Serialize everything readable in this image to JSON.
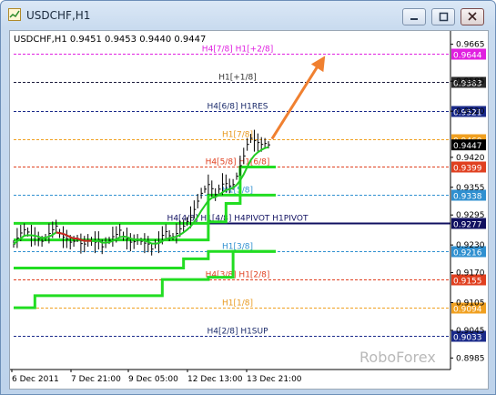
{
  "window": {
    "title": "USDCHF,H1"
  },
  "chart_data": {
    "type": "line",
    "symbol_info": "USDCHF,H1  0.9451 0.9453 0.9440 0.9447",
    "watermark": "RoboForex",
    "y_ticks": [
      "0.9665",
      "0.9585",
      "0.9520",
      "0.9420",
      "0.9355",
      "0.9295",
      "0.9230",
      "0.9170",
      "0.9105",
      "0.9045",
      "0.8985"
    ],
    "x_ticks": [
      "6 Dec 2011",
      "7 Dec 21:00",
      "9 Dec 05:00",
      "12 Dec 13:00",
      "13 Dec 21:00"
    ],
    "price_now": "0.9447",
    "ylim": [
      0.896,
      0.969
    ],
    "levels": [
      {
        "label": "H4[7/8] H1[+2/8]",
        "price_label": "0.9644",
        "price": 0.9644,
        "color": "#e020e0",
        "box_bg": "#e020e0",
        "box_fg": "#ffffff",
        "label_color": "#e020e0",
        "solid": false
      },
      {
        "label": "H1[+1/8]",
        "price_label": "0.9583",
        "price": 0.9583,
        "color": "#1a1a3a",
        "box_bg": "#2b2b2b",
        "box_fg": "#ffffff",
        "label_color": "#333333",
        "solid": false
      },
      {
        "label": "H4[6/8] H1RES",
        "price_label": "0.9521",
        "price": 0.9521,
        "color": "#1a2a8a",
        "box_bg": "#1a2a8a",
        "box_fg": "#ffffff",
        "label_color": "#1a2a6a",
        "solid": false
      },
      {
        "label": "H1[7/8]",
        "price_label": "0.9460",
        "price": 0.946,
        "color": "#f0a020",
        "box_bg": "#f0a020",
        "box_fg": "#ffffff",
        "label_color": "#e89a20",
        "solid": false
      },
      {
        "label": "H4[5/8] H1[6/8]",
        "price_label": "0.9399",
        "price": 0.9399,
        "color": "#e04020",
        "box_bg": "#e04020",
        "box_fg": "#ffffff",
        "label_color": "#e04020",
        "solid": false
      },
      {
        "label": "H1[5/8]",
        "price_label": "0.9338",
        "price": 0.9338,
        "color": "#3090d0",
        "box_bg": "#3090d0",
        "box_fg": "#ffffff",
        "label_color": "#3090d0",
        "solid": false
      },
      {
        "label": "H4[4/8] H1[4/8] H4PIVOT H1PIVOT",
        "price_label": "0.9277",
        "price": 0.9277,
        "color": "#101060",
        "box_bg": "#101060",
        "box_fg": "#ffffff",
        "label_color": "#101060",
        "solid": true
      },
      {
        "label": "H1[3/8]",
        "price_label": "0.9216",
        "price": 0.9216,
        "color": "#3090d0",
        "box_bg": "#3090d0",
        "box_fg": "#ffffff",
        "label_color": "#3090d0",
        "solid": false
      },
      {
        "label": "H4[3/8] H1[2/8]",
        "price_label": "0.9155",
        "price": 0.9155,
        "color": "#e04020",
        "box_bg": "#e04020",
        "box_fg": "#ffffff",
        "label_color": "#e04020",
        "solid": false
      },
      {
        "label": "H1[1/8]",
        "price_label": "0.9094",
        "price": 0.9094,
        "color": "#f0a020",
        "box_bg": "#f0a020",
        "box_fg": "#ffffff",
        "label_color": "#e89a20",
        "solid": false
      },
      {
        "label": "H4[2/8] H1SUP",
        "price_label": "0.9033",
        "price": 0.9033,
        "color": "#1a2a8a",
        "box_bg": "#1a2a8a",
        "box_fg": "#ffffff",
        "label_color": "#1a2a6a",
        "solid": false
      }
    ],
    "price_series": [
      0.9232,
      0.9245,
      0.9256,
      0.9263,
      0.9258,
      0.925,
      0.9249,
      0.9243,
      0.9238,
      0.9246,
      0.9255,
      0.9263,
      0.9271,
      0.9255,
      0.9247,
      0.9243,
      0.9236,
      0.9238,
      0.9244,
      0.9233,
      0.9232,
      0.924,
      0.9238,
      0.9236,
      0.924,
      0.9226,
      0.9235,
      0.924,
      0.9248,
      0.9253,
      0.9262,
      0.9249,
      0.9244,
      0.9236,
      0.9237,
      0.9242,
      0.9238,
      0.9234,
      0.9232,
      0.9221,
      0.9232,
      0.9236,
      0.9251,
      0.9259,
      0.925,
      0.9248,
      0.9255,
      0.9265,
      0.9271,
      0.9281,
      0.929,
      0.9307,
      0.9325,
      0.9342,
      0.9351,
      0.9361,
      0.9352,
      0.9339,
      0.9351,
      0.9362,
      0.9363,
      0.9358,
      0.9361,
      0.9379,
      0.9402,
      0.9423,
      0.9448,
      0.9461,
      0.9456,
      0.9452,
      0.9448,
      0.945,
      0.9447
    ],
    "ma_series": [
      0.9232,
      0.9238,
      0.9244,
      0.925,
      0.9251,
      0.9251,
      0.925,
      0.9248,
      0.9245,
      0.9246,
      0.9248,
      0.9252,
      0.9257,
      0.9256,
      0.9254,
      0.9251,
      0.9247,
      0.9244,
      0.9244,
      0.9241,
      0.9239,
      0.9239,
      0.9239,
      0.9238,
      0.9239,
      0.9235,
      0.9235,
      0.9236,
      0.9239,
      0.9242,
      0.9247,
      0.9248,
      0.9247,
      0.9244,
      0.9242,
      0.9242,
      0.9241,
      0.9239,
      0.9237,
      0.9233,
      0.9233,
      0.9234,
      0.9238,
      0.9243,
      0.9245,
      0.9246,
      0.9248,
      0.9252,
      0.9257,
      0.9263,
      0.927,
      0.928,
      0.9291,
      0.9304,
      0.9315,
      0.9326,
      0.9332,
      0.9334,
      0.9338,
      0.9344,
      0.9349,
      0.9351,
      0.9354,
      0.936,
      0.937,
      0.9383,
      0.9399,
      0.9414,
      0.9424,
      0.9431,
      0.9436,
      0.944,
      0.9442
    ],
    "ma_red_segment": {
      "from": 12,
      "to": 22
    },
    "bands": [
      {
        "name": "upper",
        "steps": [
          [
            0,
            0.9277
          ],
          [
            40,
            0.9277
          ],
          [
            44,
            0.9277
          ],
          [
            48,
            0.9277
          ],
          [
            52,
            0.9277
          ],
          [
            55,
            0.9338
          ],
          [
            58,
            0.9338
          ],
          [
            64,
            0.9399
          ],
          [
            72,
            0.9399
          ]
        ]
      },
      {
        "name": "middle",
        "steps": [
          [
            0,
            0.9241
          ],
          [
            40,
            0.9241
          ],
          [
            48,
            0.9241
          ],
          [
            55,
            0.928
          ],
          [
            60,
            0.932
          ],
          [
            64,
            0.9338
          ],
          [
            68,
            0.9338
          ],
          [
            72,
            0.9338
          ]
        ]
      },
      {
        "name": "lower",
        "steps": [
          [
            0,
            0.918
          ],
          [
            14,
            0.918
          ],
          [
            26,
            0.918
          ],
          [
            40,
            0.918
          ],
          [
            48,
            0.92
          ],
          [
            55,
            0.9216
          ],
          [
            60,
            0.9216
          ],
          [
            63,
            0.9216
          ],
          [
            72,
            0.9216
          ]
        ]
      },
      {
        "name": "bottom",
        "steps": [
          [
            0,
            0.9094
          ],
          [
            5,
            0.9094
          ],
          [
            6,
            0.912
          ],
          [
            40,
            0.912
          ],
          [
            42,
            0.9155
          ],
          [
            50,
            0.9155
          ],
          [
            52,
            0.9155
          ],
          [
            55,
            0.916
          ],
          [
            62,
            0.9216
          ],
          [
            72,
            0.9216
          ]
        ]
      }
    ],
    "grid": false,
    "arrow": {
      "color": "#f08030",
      "from_index": 73,
      "from_price": 0.946,
      "to_index": 88,
      "to_price": 0.964
    }
  }
}
